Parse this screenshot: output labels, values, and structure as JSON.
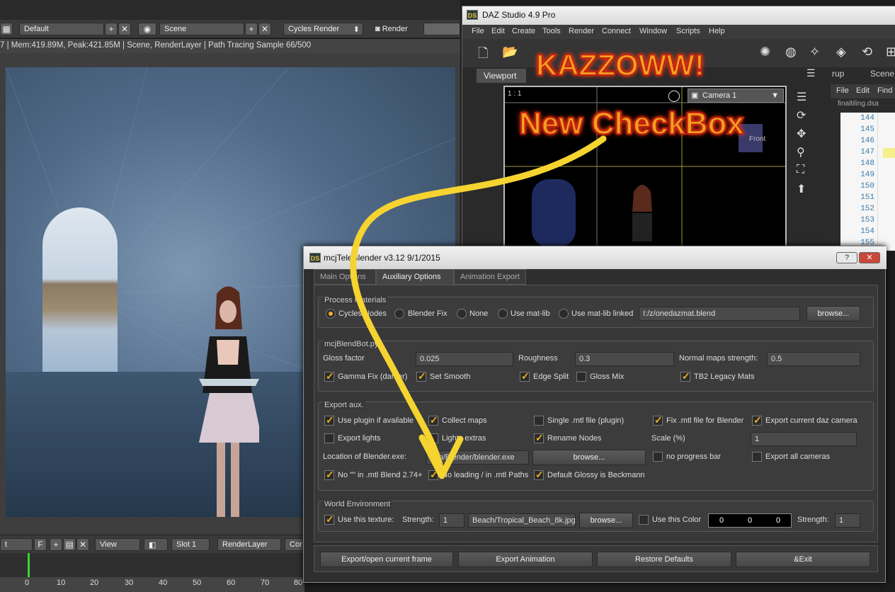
{
  "blender": {
    "layout": "Default",
    "scene": "Scene",
    "engine": "Cycles Render",
    "render_label": "Render",
    "status": "7 | Mem:419.89M, Peak:421.85M | Scene, RenderLayer | Path Tracing Sample 66/500",
    "bottom": {
      "field": "t",
      "f": "F",
      "view": "View",
      "slot": "Slot 1",
      "layer": "RenderLayer",
      "extra": "Cor"
    },
    "ruler": [
      "0",
      "10",
      "20",
      "30",
      "40",
      "50",
      "60",
      "70",
      "80"
    ]
  },
  "daz": {
    "title": "DAZ Studio 4.9 Pro",
    "menu": [
      "File",
      "Edit",
      "Create",
      "Tools",
      "Render",
      "Connect",
      "Window",
      "Scripts",
      "Help"
    ],
    "viewport_tab": "Viewport",
    "ratio": "1 : 1",
    "camera": "Camera 1",
    "right_tabs": [
      "rup",
      "Scene"
    ],
    "editor_menu": [
      "File",
      "Edit",
      "Find"
    ],
    "editor_file": "finaltiling.dsa",
    "line_numbers": [
      "144",
      "145",
      "146",
      "147",
      "148",
      "149",
      "150",
      "151",
      "152",
      "153",
      "154",
      "155"
    ],
    "front_label": "Front"
  },
  "overlay": {
    "line1": "KAZZOWW!",
    "line2": "New CheckBox"
  },
  "dialog": {
    "title": "mcjTeleBlender v3.12 9/1/2015",
    "help_btn": "?",
    "close_btn": "✕",
    "tabs": [
      "Main Options",
      "Auxiliary Options",
      "Animation Export"
    ],
    "process_materials": {
      "title": "Process materials",
      "options": [
        "Cycles Nodes",
        "Blender Fix",
        "None",
        "Use mat-lib",
        "Use mat-lib linked"
      ],
      "selected": "Cycles Nodes",
      "path": "I:/z/onedazmat.blend",
      "browse": "browse..."
    },
    "blendbot": {
      "title": "mcjBlendBot.py",
      "gloss_label": "Gloss factor",
      "gloss_value": "0.025",
      "roughness_label": "Roughness",
      "roughness_value": "0.3",
      "normal_label": "Normal maps strength:",
      "normal_value": "0.5",
      "checks": [
        {
          "label": "Gamma Fix (darker)",
          "checked": true
        },
        {
          "label": "Set Smooth",
          "checked": true
        },
        {
          "label": "Edge Split",
          "checked": true
        },
        {
          "label": "Gloss Mix",
          "checked": false
        },
        {
          "label": "TB2 Legacy Mats",
          "checked": true
        }
      ]
    },
    "export_aux": {
      "title": "Export aux.",
      "row1": [
        {
          "label": "Use plugin if available",
          "checked": true
        },
        {
          "label": "Collect maps",
          "checked": true
        },
        {
          "label": "Single .mtl file (plugin)",
          "checked": false
        },
        {
          "label": "Fix .mtl file for Blender",
          "checked": true
        },
        {
          "label": "Export current daz camera",
          "checked": true
        }
      ],
      "row2": [
        {
          "label": "Export lights",
          "checked": false
        },
        {
          "label": "Lights extras",
          "checked": false
        },
        {
          "label": "Rename Nodes",
          "checked": true
        }
      ],
      "scale_label": "Scale (%)",
      "scale_value": "1",
      "location_label": "Location of Blender.exe:",
      "location_value": "tion/Blender/blender.exe",
      "browse": "browse...",
      "row3": [
        {
          "label": "no progress bar",
          "checked": false
        },
        {
          "label": "Export all cameras",
          "checked": false
        }
      ],
      "row4": [
        {
          "label": "No \"\" in .mtl Blend 2.74+",
          "checked": true
        },
        {
          "label": "No leading / in .mtl Paths",
          "checked": true
        },
        {
          "label": "Default Glossy is Beckmann",
          "checked": true
        }
      ]
    },
    "world": {
      "title": "World Environment",
      "use_texture": "Use this texture:",
      "use_texture_checked": true,
      "strength_label": "Strength:",
      "strength_value": "1",
      "texture_path": "Beach/Tropical_Beach_8k.jpg",
      "browse": "browse...",
      "use_color": "Use this Color",
      "use_color_checked": false,
      "color_values": [
        "0",
        "0",
        "0"
      ],
      "strength2_label": "Strength:",
      "strength2_value": "1"
    },
    "footer": [
      "Export/open current frame",
      "Export Animation",
      "Restore Defaults",
      "&Exit"
    ]
  }
}
